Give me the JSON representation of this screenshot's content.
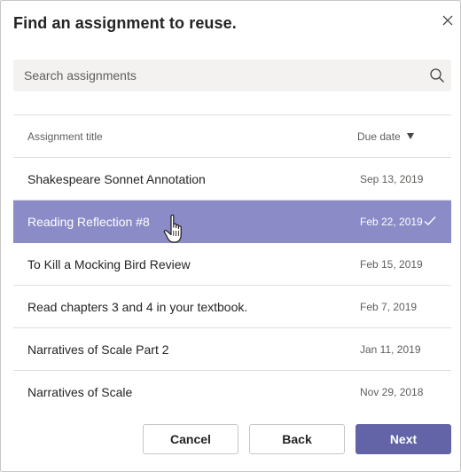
{
  "dialog": {
    "title": "Find an assignment to reuse."
  },
  "search": {
    "placeholder": "Search assignments",
    "value": ""
  },
  "table": {
    "headers": {
      "title": "Assignment title",
      "due_date": "Due date",
      "sort_direction": "descending"
    },
    "rows": [
      {
        "title": "Shakespeare Sonnet Annotation",
        "due": "Sep 13, 2019",
        "selected": false
      },
      {
        "title": "Reading Reflection #8",
        "due": "Feb 22, 2019",
        "selected": true
      },
      {
        "title": "To Kill a Mocking Bird Review",
        "due": "Feb 15, 2019",
        "selected": false
      },
      {
        "title": "Read chapters 3 and 4 in your textbook.",
        "due": "Feb 7, 2019",
        "selected": false
      },
      {
        "title": "Narratives of Scale Part 2",
        "due": "Jan 11, 2019",
        "selected": false
      },
      {
        "title": "Narratives of Scale",
        "due": "Nov 29, 2018",
        "selected": false
      }
    ]
  },
  "footer": {
    "cancel_label": "Cancel",
    "back_label": "Back",
    "next_label": "Next"
  },
  "icons": {
    "close": "close-icon",
    "search": "search-icon",
    "sort": "caret-down-icon",
    "selected": "check-icon",
    "pointer": "hand-cursor-icon"
  },
  "colors": {
    "accent": "#6264a7",
    "selected_row": "#8b8cc7",
    "surface": "#ffffff",
    "search_bg": "#f3f2f1",
    "divider": "#e1dfdd",
    "text_primary": "#252423",
    "text_secondary": "#605e5c"
  }
}
